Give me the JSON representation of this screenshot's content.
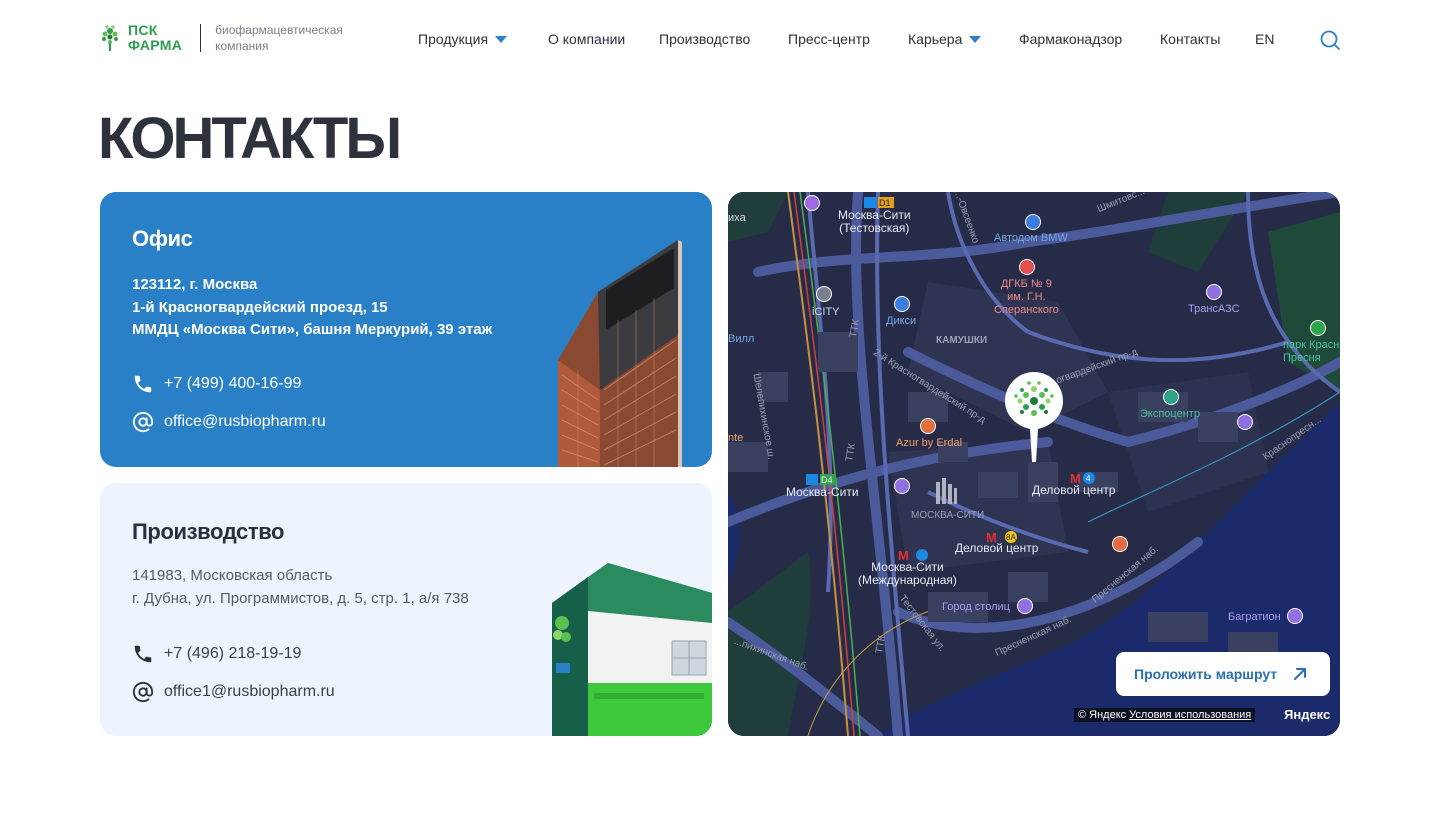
{
  "header": {
    "logo_line1": "ПСК",
    "logo_line2": "ФАРМА",
    "logo_subtitle": "биофармацевтическая компания",
    "nav": [
      {
        "label": "Продукция",
        "has_dropdown": true
      },
      {
        "label": "О компании",
        "has_dropdown": false
      },
      {
        "label": "Производство",
        "has_dropdown": false
      },
      {
        "label": "Пресс-центр",
        "has_dropdown": false
      },
      {
        "label": "Карьера",
        "has_dropdown": true
      },
      {
        "label": "Фармаконадзор",
        "has_dropdown": false
      },
      {
        "label": "Контакты",
        "has_dropdown": false
      },
      {
        "label": "EN",
        "has_dropdown": false
      }
    ],
    "search_icon": "search-icon"
  },
  "page": {
    "title": "КОНТАКТЫ"
  },
  "office": {
    "title": "Офис",
    "address_lines": [
      "123112, г. Москва",
      "1-й Красногвардейский проезд, 15",
      "ММДЦ «Москва Сити», башня Меркурий, 39 этаж"
    ],
    "phone": "+7 (499) 400-16-99",
    "email": "office@rusbiopharm.ru"
  },
  "production": {
    "title": "Производство",
    "address_lines": [
      "141983, Московская область",
      "г. Дубна, ул. Программистов, д. 5, стр. 1, а/я 738"
    ],
    "phone": "+7 (496) 218-19-19",
    "email": "office1@rusbiopharm.ru"
  },
  "map": {
    "labels": {
      "moscow_city_testovskaya": "Москва-Сити\n(Тестовская)",
      "d1": "D1",
      "autodom": "Автодом BMW",
      "dgkb": "ДГКБ № 9\nим. Г.Н.\nСперанского",
      "shmitovsky": "Шмитовс...",
      "transazs": "ТрансАЗС",
      "park": "парк Красн...\nПресня",
      "icity": "iCITY",
      "dixi": "Дикси",
      "kamushki": "КАМУШКИ",
      "ttk": "ТТК",
      "krasnogvard": "2-й Красногвардейский пр-д",
      "gvard": "огвардейский пр-д",
      "expocentr": "Экспоцентр",
      "azur": "Azur by Erdal",
      "nte": "nte",
      "vill": "Вилл",
      "ikha": "ихa",
      "shelepikhinsky": "Шелепихинское ш.",
      "mc_d4": "Москва-Сити",
      "d4": "D4",
      "moskva_siti_caps": "МОСКВА-СИТИ",
      "delovoy1": "Деловой центр",
      "delovoy2": "Деловой центр",
      "mc_int": "Москва-Сити\n(Международная)",
      "gorod_stolic": "Город столиц",
      "bagration": "Багратион",
      "krasnopresnenskaya": "Краснопресн...",
      "presnenskaya1": "Пресненская наб.",
      "presnenskaya2": "Пресненская наб.",
      "testovskaya_ul": "Тестовская ул.",
      "shelepikh_nab": "...пихинская наб.",
      "ovchinnikov": "...-Овсеенко",
      "line4": "4",
      "line8a": "8А"
    },
    "route_button": "Проложить маршрут",
    "copyright": "© Яндекс",
    "terms": "Условия использования",
    "brand": "Яндекс"
  },
  "colors": {
    "brand_blue": "#2a80c7",
    "brand_green": "#2e9c4e",
    "card_light": "#eef4fd",
    "map_bg": "#262c47"
  }
}
